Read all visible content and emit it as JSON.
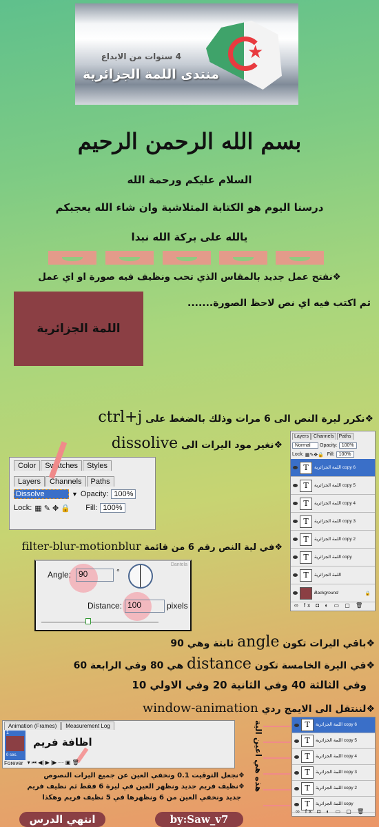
{
  "header": {
    "logo_tagline": "4 سنوات من الابداع",
    "logo_title": "منتدى اللمة الجزائرية"
  },
  "basmala": "بسم الله الرحمن الرحيم",
  "intro": [
    "السلام عليكم ورحمة الله",
    "درسنا اليوم هو الكتابة المتلاشية وان شاء الله يعجبكم",
    "يالله على بركة الله نبدا"
  ],
  "colors": {
    "accent": "#8b3f44",
    "banner": "#e39b8a"
  },
  "steps": {
    "s1": "❖نفتح عمل جديد بالمقاس الذي تحب ونظيف فيه صورة او اي عمل",
    "s2": "ثم اكتب فيه اي نص لاحظ الصورة.......",
    "sample_text": "اللمة الجزائرية",
    "s3": "❖نكرر ليرة النص الى 6 مرات وذلك بالضغط على ",
    "s3_key": "ctrl+j",
    "s4": "❖نغير مود اليرات الى ",
    "s4_mode": "dissolive",
    "s5": "❖في لية النص رقم 6 من قائمة ",
    "s5_menu": "filter-blur-motionblur",
    "s6a": "❖باقي اليرات تكون ",
    "s6_angle": "angle",
    "s6b": " ثابتة وهي 90",
    "s7a": "❖في اليرة الخامسة تكون ",
    "s7_distance": "distance",
    "s7b": " هي 80 وفي الرابعة 60",
    "s8": "وفي الثالثة 40 وفي الثانية 20 وفي الاولي 10",
    "s9": "❖لننتقل الى الايمج ردي ",
    "s9_menu": "window-animation",
    "s10": "❖نجعل التوقيت 0.1 ونخفي العين عن جميع اليرات النصوص",
    "s11": "❖نظيف فريم جديد ونظهر العين في ليرة 6 فقط ثم نظيف فريم",
    "s12": "جديد ونخفي العين من 6 ونظهرها في 5 نظيف فريم وهكذا",
    "add_frame": "اظافة فريم",
    "eyes_label": "هذه هي اعين الية"
  },
  "blend_panel": {
    "tabs1": [
      "Color",
      "Swatches",
      "Styles"
    ],
    "tabs2": [
      "Layers",
      "Channels",
      "Paths"
    ],
    "mode": "Dissolve",
    "opacity_label": "Opacity:",
    "opacity": "100%",
    "lock_label": "Lock:",
    "fill_label": "Fill:",
    "fill": "100%"
  },
  "layers_panel": {
    "tabs": [
      "Layers",
      "Channels",
      "Paths"
    ],
    "mode": "Normal",
    "opacity_label": "Opacity:",
    "opacity": "100%",
    "lock_label": "Lock:",
    "fill_label": "Fill:",
    "fill": "100%",
    "layers": [
      "اللمة الجزائرية copy 6",
      "اللمة الجزائرية copy 5",
      "اللمة الجزائرية copy 4",
      "اللمة الجزائرية copy 3",
      "اللمة الجزائرية copy 2",
      "اللمة الجزائرية copy",
      "اللمة الجزائرية",
      "Background"
    ]
  },
  "motion_blur": {
    "watermark": "Dantela",
    "angle_label": "Angle:",
    "angle": "90",
    "degree": "°",
    "distance_label": "Distance:",
    "distance": "100",
    "unit": "pixels"
  },
  "animation_panel": {
    "tabs": [
      "Animation (Frames)",
      "Measurement Log"
    ],
    "frame_number": "1",
    "frame_time": "0 sec.",
    "loop": "Forever"
  },
  "footer": {
    "end": "انتهي الدرس",
    "author": "by:Saw_v7"
  }
}
